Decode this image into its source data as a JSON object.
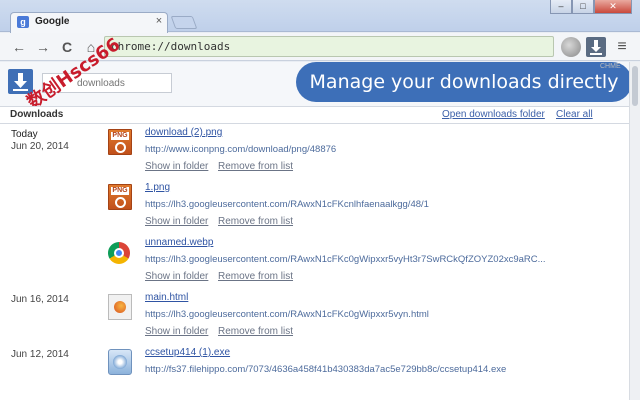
{
  "browser": {
    "tab_title": "Google",
    "tab_close": "×",
    "tab_icon": "g",
    "window_buttons": {
      "minimize": "–",
      "maximize": "□",
      "close": "✕"
    },
    "back": "←",
    "forward": "→",
    "reload": "C",
    "home": "⌂",
    "address": "chrome://downloads",
    "menu": "≡"
  },
  "header": {
    "search_placeholder": "downloads",
    "watermark": "数创Hscs66",
    "banner": "Manage your downloads directly",
    "banner_tiny": "CHME"
  },
  "section": {
    "title": "Downloads",
    "open_folder": "Open downloads folder",
    "clear_all": "Clear all"
  },
  "actions": {
    "show_in_folder": "Show in folder",
    "remove": "Remove from list"
  },
  "downloads": [
    {
      "date_label": "Today",
      "date": "Jun 20, 2014",
      "name": "download (2).png",
      "url": "http://www.iconpng.com/download/png/48876",
      "icon": "png-file-icon"
    },
    {
      "date_label": "",
      "date": "",
      "name": "1.png",
      "url": "https://lh3.googleusercontent.com/RAwxN1cFKcnlhfaenaalkgg/48/1",
      "icon": "png-file-icon"
    },
    {
      "date_label": "",
      "date": "",
      "name": "unnamed.webp",
      "url": "https://lh3.googleusercontent.com/RAwxN1cFKc0gWipxxr5vyHt3r7SwRCkQfZOYZ02xc9aRC...",
      "icon": "chrome-file-icon"
    },
    {
      "date_label": "",
      "date": "Jun 16, 2014",
      "name": "main.html",
      "url": "https://lh3.googleusercontent.com/RAwxN1cFKc0gWipxxr5vyn.html",
      "icon": "firefox-file-icon"
    },
    {
      "date_label": "",
      "date": "Jun 12, 2014",
      "name": "ccsetup414 (1).exe",
      "url": "http://fs37.filehippo.com/7073/4636a458f41b430383da7ac5e729bb8c/ccsetup414.exe",
      "icon": "exe-file-icon"
    }
  ],
  "colors": {
    "banner": "#3d6fb8",
    "link": "#2f54a3",
    "watermark": "#c81c2c"
  }
}
